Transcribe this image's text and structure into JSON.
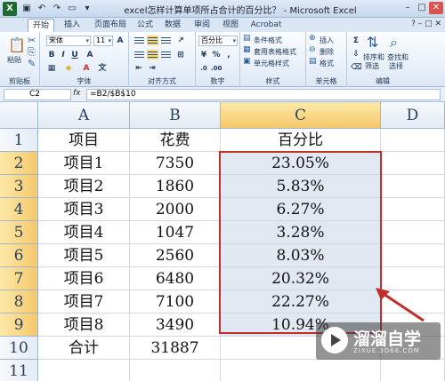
{
  "window": {
    "title": "excel怎样计算单项所占合计的百分比？ - Microsoft Excel",
    "app_icon": "excel-icon",
    "controls": [
      "minimize-icon",
      "maximize-icon",
      "close-icon"
    ]
  },
  "ribbon_tabs": [
    "开始",
    "插入",
    "页面布局",
    "公式",
    "数据",
    "审阅",
    "视图",
    "Acrobat"
  ],
  "ribbon": {
    "clipboard": {
      "paste": "粘贴",
      "label": "剪贴板"
    },
    "font": {
      "name": "宋体",
      "size": "11",
      "label": "字体"
    },
    "alignment": {
      "label": "对齐方式"
    },
    "number": {
      "format": "百分比",
      "label": "数字"
    },
    "styles": {
      "conditional": "条件格式",
      "table": "套用表格格式",
      "cell": "单元格样式",
      "label": "样式"
    },
    "cells": {
      "insert": "插入",
      "delete": "删除",
      "format": "格式",
      "label": "单元格"
    },
    "editing": {
      "sort": "排序和",
      "sort2": "筛选",
      "find": "查找和",
      "find2": "选择",
      "label": "编辑"
    }
  },
  "formula_bar": {
    "name_box": "C2",
    "fx": "fx",
    "formula": "=B2/$B$10"
  },
  "sheet": {
    "columns": [
      "A",
      "B",
      "C",
      "D"
    ],
    "rows": [
      {
        "num": "1",
        "a": "项目",
        "b": "花费",
        "c": "百分比"
      },
      {
        "num": "2",
        "a": "项目1",
        "b": "7350",
        "c": "23.05%"
      },
      {
        "num": "3",
        "a": "项目2",
        "b": "1860",
        "c": "5.83%"
      },
      {
        "num": "4",
        "a": "项目3",
        "b": "2000",
        "c": "6.27%"
      },
      {
        "num": "5",
        "a": "项目4",
        "b": "1047",
        "c": "3.28%"
      },
      {
        "num": "6",
        "a": "项目5",
        "b": "2560",
        "c": "8.03%"
      },
      {
        "num": "7",
        "a": "项目6",
        "b": "6480",
        "c": "20.32%"
      },
      {
        "num": "8",
        "a": "项目7",
        "b": "7100",
        "c": "22.27%"
      },
      {
        "num": "9",
        "a": "项目8",
        "b": "3490",
        "c": "10.94%"
      },
      {
        "num": "10",
        "a": "合计",
        "b": "31887",
        "c": ""
      },
      {
        "num": "11",
        "a": "",
        "b": "",
        "c": ""
      }
    ]
  },
  "watermark": {
    "text": "溜溜自学",
    "url": "ZIXUE.3D66.COM"
  },
  "colors": {
    "selection": "#c0302a",
    "header_selected": "#f5c86a"
  }
}
